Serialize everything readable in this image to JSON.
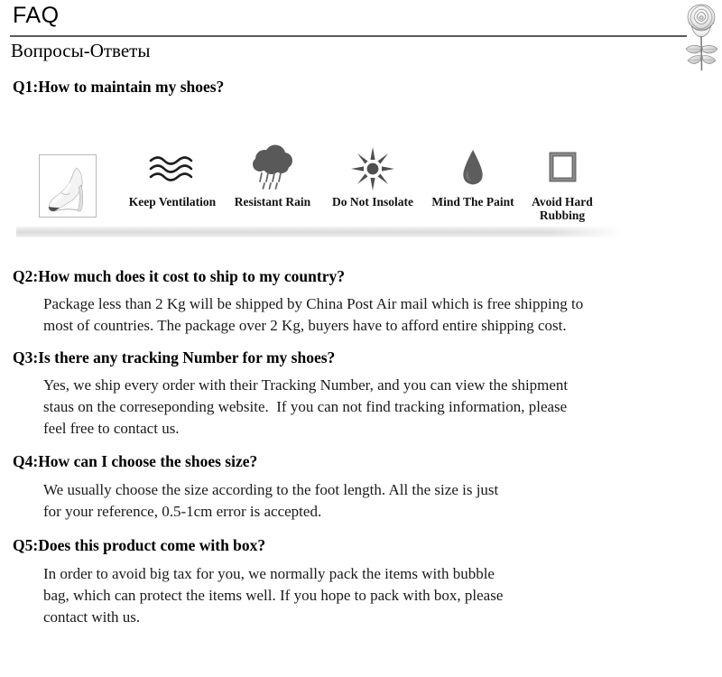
{
  "header": {
    "title": "FAQ",
    "subtitle": "Вопросы-Ответы",
    "rose_icon": "rose-sketch-icon"
  },
  "care_strip": {
    "product_image_alt": "white-high-heel-shoe",
    "items": [
      {
        "icon": "wavy-lines-icon",
        "label": "Keep Ventilation"
      },
      {
        "icon": "rain-cloud-icon",
        "label": "Resistant Rain"
      },
      {
        "icon": "sun-icon",
        "label": "Do Not Insolate"
      },
      {
        "icon": "water-drop-icon",
        "label": "Mind The Paint"
      },
      {
        "icon": "hollow-square-icon",
        "label": "Avoid Hard Rubbing"
      }
    ]
  },
  "faq": [
    {
      "question": "Q1:How to maintain my shoes?",
      "answer_lines": []
    },
    {
      "question": "Q2:How much does it cost to ship to my country?",
      "answer_lines": [
        "Package less than 2 Kg will be shipped by China Post Air mail which is free shipping to",
        "most of countries. The package over 2 Kg, buyers have to afford entire shipping cost."
      ]
    },
    {
      "question": "Q3:Is there any tracking Number for my shoes?",
      "answer_lines": [
        "Yes, we ship every order with their Tracking Number, and you can view the shipment",
        "staus on the correseponding website.  If you can not find tracking information, please",
        "feel free to contact us."
      ]
    },
    {
      "question": "Q4:How can I choose the shoes size?",
      "answer_lines": [
        "We usually choose the size according to the foot length. All the size is just",
        "for your reference, 0.5-1cm error is accepted."
      ]
    },
    {
      "question": "Q5:Does this product come with box?",
      "answer_lines": [
        "In order to avoid big tax for you, we normally pack the items with bubble",
        "bag, which can protect the items well. If you hope to pack with box, please",
        "contact with us."
      ]
    }
  ],
  "colors": {
    "text": "#000000",
    "rule": "#5a5a5a",
    "icon_gray": "#5a5a5a",
    "band": "#dcdcdc",
    "box_border": "#b9b9b9"
  }
}
